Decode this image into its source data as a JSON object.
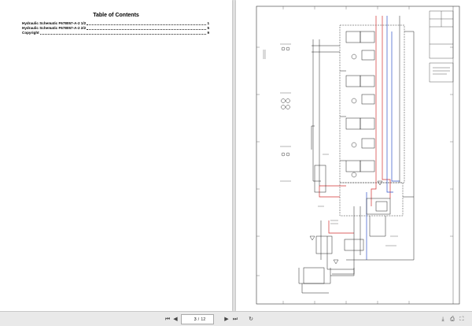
{
  "toc": {
    "title": "Table of Contents",
    "entries": [
      {
        "title": "Hydraulic Schematic F678057-A-2 1/2",
        "page": "1"
      },
      {
        "title": "Hydraulic Schematic F678057-A-2 2/2",
        "page": "5"
      },
      {
        "title": "Copyright",
        "page": "9"
      }
    ]
  },
  "toolbar": {
    "first_icon": "⏮",
    "prev_icon": "◀",
    "current_page": "3",
    "page_separator": "/",
    "total_pages": "12",
    "next_icon": "▶",
    "last_icon": "⏭",
    "rotate_icon": "↻",
    "download_icon": "⤓",
    "print_icon": "⎙",
    "fullscreen_icon": "⛶"
  },
  "colors": {
    "background": "#e3e3e3",
    "line_black": "#222222",
    "line_red": "#d23030",
    "line_blue": "#2f52c8"
  }
}
